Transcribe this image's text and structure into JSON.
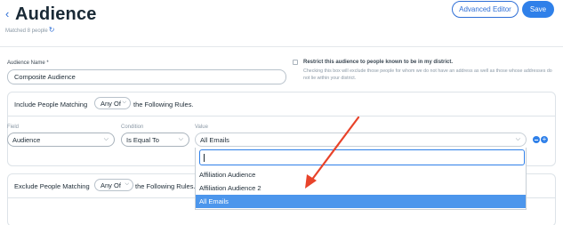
{
  "header": {
    "back_icon": "chevron-left-icon",
    "title": "Audience",
    "matched_text": "Matched 8 people",
    "refresh_icon": "refresh-icon",
    "advanced_editor_label": "Advanced Editor",
    "save_label": "Save",
    "accent_color": "#2f80e9"
  },
  "audience_name": {
    "label": "Audience Name *",
    "value": "Composite Audience"
  },
  "restrict": {
    "label": "Restrict this audience to people known to be in my district.",
    "help": "Checking this box will exclude those people for whom we do not have an address as well as those whose addresses do not lie within your district.",
    "checked": false
  },
  "include": {
    "prefix": "Include People Matching",
    "match": "Any Of",
    "suffix": "the Following Rules.",
    "field_label": "Field",
    "condition_label": "Condition",
    "value_label": "Value",
    "field_value": "Audience",
    "condition_value": "Is Equal To",
    "value_value": "All Emails"
  },
  "dropdown": {
    "search_value": "",
    "options": [
      "Affiliation Audience",
      "Affiliation Audience 2",
      "All Emails"
    ],
    "selected": "All Emails"
  },
  "exclude": {
    "prefix": "Exclude People Matching",
    "match": "Any Of",
    "suffix": "the Following Rules."
  },
  "annotation": {
    "arrow_color": "#e8432a"
  }
}
